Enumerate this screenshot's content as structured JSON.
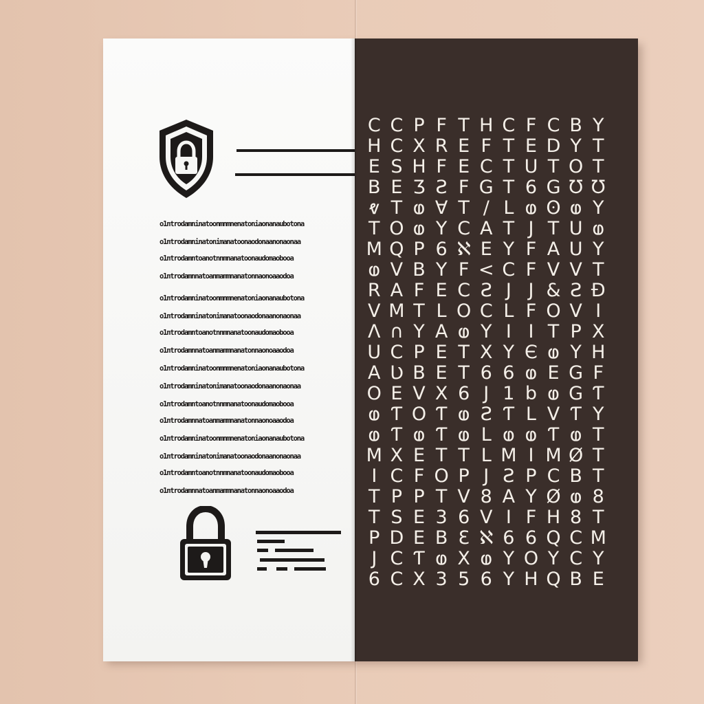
{
  "scene": {
    "background_color": "#e8c9b5",
    "plain_page_color": "#f7f7f5",
    "cipher_panel_color": "#3a2e2a",
    "ink_color": "#1d1a19",
    "cipher_text_color": "#f4efe8"
  },
  "plain_document": {
    "icons": [
      "shield-lock-icon",
      "padlock-icon"
    ],
    "text_lines": [
      "o1ntrodamninatoonmnmnenatoniaonanaubotona",
      "o1ntrodamninatonimanatoonaodonaanonaonaa",
      "o1ntrodamntoanotnnmnanatoonaudomaobooa",
      "o1ntrodamnnatoanmammnanatonnaonoaaodoa",
      "o1ntrodamninatoonmnmnenatoniaonanaubotona",
      "o1ntrodamninatonimanatoonaodonaanonaonaa",
      "o1ntrodamntoanotnnmnanatoonaudomaobooa",
      "o1ntrodamnnatoanmammnanatonnaonoaaodoa",
      "o1ntrodamninatoonmnmnenatoniaonanaubotona",
      "o1ntrodamninatonimanatoonaodonaanonaonaa",
      "o1ntrodamntoanotnnmnanatoonaudomaobooa",
      "o1ntrodamnnatoanmammnanatonnaonoaaodoa",
      "o1ntrodamninatoonmnmnenatoniaonanaubotona",
      "o1ntrodamninatonimanatoonaodonaanonaonaa",
      "o1ntrodamntoanotnnmnanatoonaudomaobooa",
      "o1ntrodamnnatoanmammnanatonnaonoaaodoa"
    ]
  },
  "cipher_document": {
    "rows": [
      [
        "C",
        "C",
        "P",
        "F",
        "T",
        "H",
        "C",
        "F",
        "C",
        "B",
        "Y"
      ],
      [
        "H",
        "C",
        "X",
        "R",
        "E",
        "F",
        "T",
        "E",
        "D",
        "Y",
        "T"
      ],
      [
        "E",
        "S",
        "H",
        "F",
        "E",
        "C",
        "T",
        "U",
        "T",
        "O",
        "T"
      ],
      [
        "B",
        "E",
        "Ʒ",
        "Ƨ",
        "F",
        "G",
        "T",
        "6",
        "G",
        "Ʊ",
        "Ʊ"
      ],
      [
        "ⱴ",
        "T",
        "ⱷ",
        "Ɐ",
        "T",
        "/",
        "L",
        "ⱷ",
        "ʘ",
        "ⱷ",
        "Y"
      ],
      [
        "T",
        "O",
        "ⱷ",
        "Y",
        "C",
        "A",
        "T",
        "J",
        "T",
        "U",
        "ⱷ"
      ],
      [
        "M",
        "Q",
        "P",
        "6",
        "ℵ",
        "E",
        "Y",
        "F",
        "A",
        "U",
        "Y"
      ],
      [
        "ⱷ",
        "V",
        "B",
        "Y",
        "F",
        "<",
        "C",
        "F",
        "V",
        "V",
        "T"
      ],
      [
        "R",
        "A",
        "F",
        "E",
        "C",
        "Ƨ",
        "J",
        "J",
        "&",
        "Ƨ",
        "Ð"
      ],
      [
        "V",
        "M",
        "T",
        "L",
        "O",
        "C",
        "L",
        "F",
        "O",
        "V",
        "I"
      ],
      [
        "Ʌ",
        "∩",
        "Y",
        "A",
        "ⱷ",
        "Y",
        "I",
        "I",
        "T",
        "P",
        "X"
      ],
      [
        "U",
        "C",
        "P",
        "E",
        "T",
        "X",
        "Y",
        "Є",
        "ⱷ",
        "Y",
        "H"
      ],
      [
        "A",
        "Ʋ",
        "B",
        "E",
        "T",
        "6",
        "6",
        "ⱷ",
        "E",
        "G",
        "F"
      ],
      [
        "O",
        "E",
        "V",
        "X",
        "6",
        "J",
        "1",
        "b",
        "ⱷ",
        "G",
        "Ƭ"
      ],
      [
        "ⱷ",
        "Ƭ",
        "O",
        "Ƭ",
        "ⱷ",
        "Ƨ",
        "Ƭ",
        "L",
        "V",
        "Ƭ",
        "Y"
      ],
      [
        "ⱷ",
        "Ƭ",
        "ⱷ",
        "Ƭ",
        "ⱷ",
        "L",
        "ⱷ",
        "ⱷ",
        "Ƭ",
        "ⱷ",
        "T"
      ],
      [
        "M",
        "X",
        "E",
        "T",
        "T",
        "L",
        "M",
        "I",
        "M",
        "Ø",
        "T"
      ],
      [
        "I",
        "C",
        "F",
        "O",
        "P",
        "J",
        "Ƨ",
        "P",
        "C",
        "B",
        "T"
      ],
      [
        "T",
        "P",
        "P",
        "T",
        "V",
        "8",
        "A",
        "Y",
        "Ø",
        "ⱷ",
        "8"
      ],
      [
        "T",
        "S",
        "E",
        "3",
        "6",
        "V",
        "I",
        "F",
        "H",
        "8",
        "T"
      ],
      [
        "P",
        "D",
        "E",
        "B",
        "Ɛ",
        "ℵ",
        "6",
        "6",
        "Q",
        "C",
        "M"
      ],
      [
        "J",
        "C",
        "Ƭ",
        "ⱷ",
        "X",
        "ⱷ",
        "Y",
        "O",
        "Y",
        "C",
        "Y"
      ],
      [
        "6",
        "C",
        "X",
        "3",
        "5",
        "6",
        "Y",
        "H",
        "Q",
        "B",
        "E"
      ]
    ]
  }
}
